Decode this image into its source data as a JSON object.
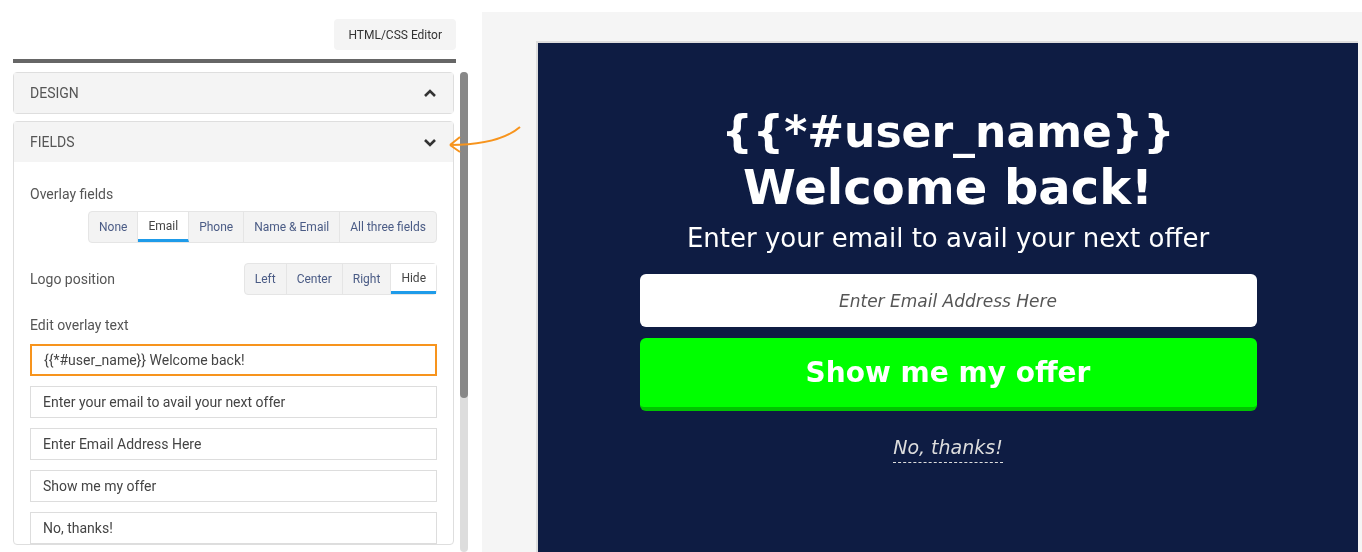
{
  "editor_button": "HTML/CSS Editor",
  "sections": [
    {
      "title": "DESIGN",
      "expanded": false
    },
    {
      "title": "FIELDS",
      "expanded": true
    }
  ],
  "overlay_fields": {
    "label": "Overlay fields",
    "options": [
      {
        "label": "None",
        "selected": false
      },
      {
        "label": "Email",
        "selected": true
      },
      {
        "label": "Phone",
        "selected": false
      },
      {
        "label": "Name & Email",
        "selected": false
      },
      {
        "label": "All three fields",
        "selected": false
      }
    ]
  },
  "logo_position": {
    "label": "Logo position",
    "options": [
      {
        "label": "Left",
        "selected": false
      },
      {
        "label": "Center",
        "selected": false
      },
      {
        "label": "Right",
        "selected": false
      },
      {
        "label": "Hide",
        "selected": true
      }
    ]
  },
  "overlay_text": {
    "label": "Edit overlay text",
    "fields": [
      {
        "value": "{{*#user_name}} Welcome back!",
        "highlighted": true
      },
      {
        "value": "Enter your email to avail your next offer",
        "highlighted": false
      },
      {
        "value": "Enter Email Address Here",
        "highlighted": false
      },
      {
        "value": "Show me my offer",
        "highlighted": false
      },
      {
        "value": "No, thanks!",
        "highlighted": false
      }
    ]
  },
  "preview": {
    "heading_1": "{{*#user_name}}",
    "heading_2": "Welcome back!",
    "subtitle": "Enter your email to avail your next offer",
    "email_placeholder": "Enter Email Address Here",
    "submit_button": "Show me my offer",
    "decline_link": "No, thanks!"
  }
}
